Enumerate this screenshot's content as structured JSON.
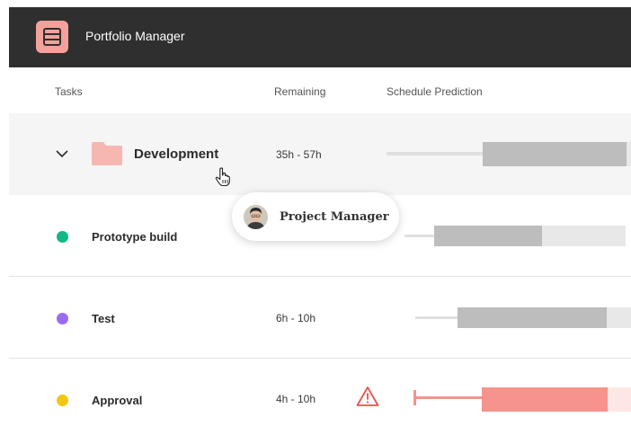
{
  "header": {
    "title": "Portfolio Manager",
    "logo": "app-logo-icon"
  },
  "columns": {
    "tasks": "Tasks",
    "remaining": "Remaining",
    "schedule": "Schedule Prediction"
  },
  "group": {
    "name": "Development",
    "remaining": "35h - 57h",
    "expanded": true
  },
  "tasks": [
    {
      "name": "Prototype build",
      "remaining": "",
      "status_color": "#12b886"
    },
    {
      "name": "Test",
      "remaining": "6h - 10h",
      "status_color": "#9b6cf2"
    },
    {
      "name": "Approval",
      "remaining": "4h - 10h",
      "status_color": "#f2c614",
      "warning": true
    }
  ],
  "tooltip": {
    "label": "Project Manager"
  },
  "colors": {
    "header_bg": "#2f2f2f",
    "accent": "#f2a29b",
    "bar_gray": "#bdbdbd",
    "bar_light": "#e8e8e8",
    "bar_red": "#f5938c",
    "warning": "#e8534a"
  }
}
